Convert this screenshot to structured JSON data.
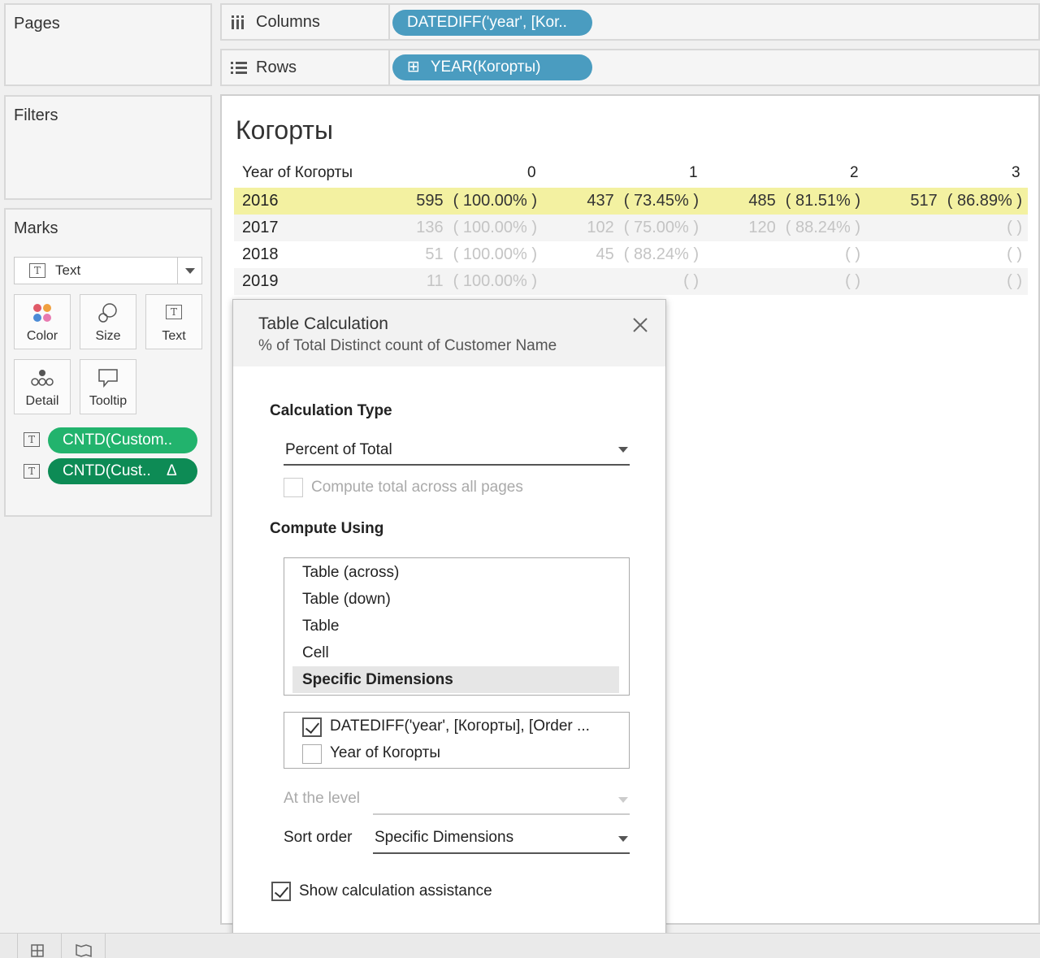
{
  "left_panels": {
    "pages": {
      "title": "Pages"
    },
    "filters": {
      "title": "Filters"
    },
    "marks": {
      "title": "Marks",
      "mark_type": "Text",
      "buttons": [
        "Color",
        "Size",
        "Text",
        "Detail",
        "Tooltip"
      ],
      "fields": [
        {
          "label": "CNTD(Custom..",
          "color": "#22b36d"
        },
        {
          "label": "CNTD(Cust..",
          "delta": "Δ",
          "color": "#0d8b55"
        }
      ]
    }
  },
  "shelves": {
    "columns": {
      "label": "Columns",
      "pill": "DATEDIFF('year', [Kor.."
    },
    "rows": {
      "label": "Rows",
      "pill": "YEAR(Когорты)",
      "pill_icon": "⊞"
    }
  },
  "view": {
    "title": "Когорты",
    "row_header": "Year of Когорты",
    "col_headers": [
      "0",
      "1",
      "2",
      "3"
    ],
    "highlight_color": "#f3f1a1",
    "rows": [
      {
        "year": "2016",
        "cells": [
          {
            "n": "595",
            "p": "( 100.00% )"
          },
          {
            "n": "437",
            "p": "( 73.45% )"
          },
          {
            "n": "485",
            "p": "( 81.51% )"
          },
          {
            "n": "517",
            "p": "( 86.89% )"
          }
        ]
      },
      {
        "year": "2017",
        "cells": [
          {
            "n": "136",
            "p": "( 100.00% )"
          },
          {
            "n": "102",
            "p": "( 75.00% )"
          },
          {
            "n": "120",
            "p": "( 88.24% )"
          },
          {
            "n": "",
            "p": "( )"
          }
        ]
      },
      {
        "year": "2018",
        "cells": [
          {
            "n": "51",
            "p": "( 100.00% )"
          },
          {
            "n": "45",
            "p": "( 88.24% )"
          },
          {
            "n": "",
            "p": "( )"
          },
          {
            "n": "",
            "p": "( )"
          }
        ]
      },
      {
        "year": "2019",
        "cells": [
          {
            "n": "11",
            "p": "( 100.00% )"
          },
          {
            "n": "",
            "p": "( )"
          },
          {
            "n": "",
            "p": "( )"
          },
          {
            "n": "",
            "p": "( )"
          }
        ]
      }
    ]
  },
  "dialog": {
    "title": "Table Calculation",
    "subtitle": "% of Total Distinct count of Customer Name",
    "calc_type_label": "Calculation Type",
    "calc_type_value": "Percent of Total",
    "compute_total_label": "Compute total across all pages",
    "compute_using_label": "Compute Using",
    "compute_options": [
      "Table (across)",
      "Table (down)",
      "Table",
      "Cell",
      "Specific Dimensions"
    ],
    "selected_option": "Specific Dimensions",
    "dimensions": [
      {
        "label": "DATEDIFF('year', [Когорты], [Order ...",
        "checked": true
      },
      {
        "label": "Year of Когорты",
        "checked": false
      }
    ],
    "at_level_label": "At the level",
    "sort_order_label": "Sort order",
    "sort_order_value": "Specific Dimensions",
    "show_assist_label": "Show calculation assistance",
    "show_assist_checked": true
  }
}
